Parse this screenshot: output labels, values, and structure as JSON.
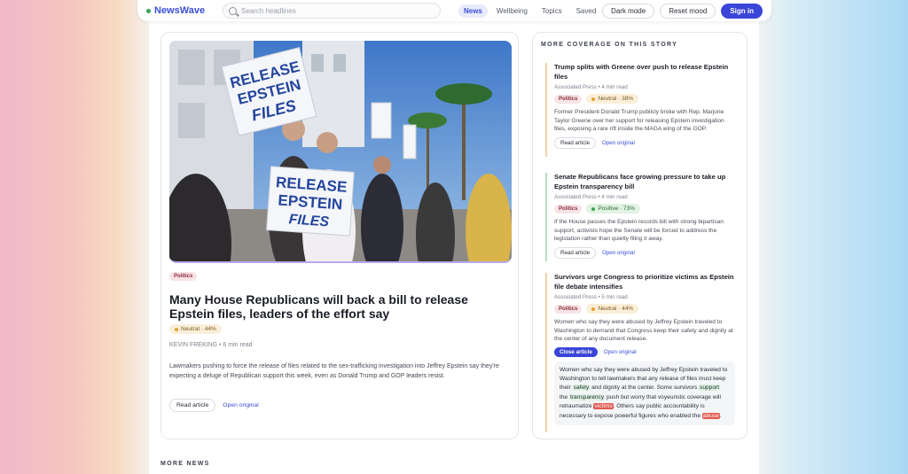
{
  "app": {
    "brand": "NewsWave"
  },
  "search": {
    "placeholder": "Search headlines"
  },
  "nav": {
    "items": [
      "News",
      "Wellbeing",
      "Topics",
      "Saved"
    ],
    "active": "News"
  },
  "actions": {
    "dark_mode": "Dark mode",
    "reset_mood": "Reset mood",
    "sign_in": "Sign in"
  },
  "colors": {
    "accent": "#3a46d8",
    "neutral": "#e2a12e",
    "positive": "#3da24f",
    "negative": "#e05a4e"
  },
  "main_story": {
    "image_signs": {
      "line1": "RELEASE",
      "line2": "EPSTEIN",
      "line3": "FILES"
    },
    "topic": "Politics",
    "title": "Many House Republicans will back a bill to release Epstein files, leaders of the effort say",
    "sentiment": "Neutral · 44%",
    "byline": "KEVIN FREKING • 6 min read",
    "summary": "Lawmakers pushing to force the release of files related to the sex-trafficking investigation into Jeffrey Epstein say they're expecting a deluge of Republican support this week, even as Donald Trump and GOP leaders resist.",
    "read_label": "Read article",
    "open_label": "Open original"
  },
  "coverage": {
    "heading": "MORE COVERAGE ON THIS STORY",
    "stories": [
      {
        "title": "Trump splits with Greene over push to release Epstein files",
        "byline": "Associated Press • 4 min read",
        "topic": "Politics",
        "sentiment": "Neutral · 38%",
        "summary": "Former President Donald Trump publicly broke with Rep. Marjorie Taylor Greene over her support for releasing Epstein investigation files, exposing a rare rift inside the MAGA wing of the GOP.",
        "read_label": "Read article",
        "open_label": "Open original"
      },
      {
        "title": "Senate Republicans face growing pressure to take up Epstein transparency bill",
        "byline": "Associated Press • 4 min read",
        "topic": "Politics",
        "sentiment": "Positive · 73%",
        "summary": "If the House passes the Epstein records bill with strong bipartisan support, activists hope the Senate will be forced to address the legislation rather than quietly filing it away.",
        "read_label": "Read article",
        "open_label": "Open original"
      },
      {
        "title": "Survivors urge Congress to prioritize victims as Epstein file debate intensifies",
        "byline": "Associated Press • 5 min read",
        "topic": "Politics",
        "sentiment": "Neutral · 44%",
        "summary": "Women who say they were abused by Jeffrey Epstein traveled to Washington to demand that Congress keep their safety and dignity at the center of any document release.",
        "close_label": "Close article",
        "open_label": "Open original",
        "analysis": {
          "p1": "Women who say they were abused by Jeffrey Epstein traveled to Washington to tell lawmakers that any release of files must keep their ",
          "w_safety": "safety",
          "p2": " and dignity at the center. Some survivors ",
          "w_support": "support",
          "p3": " the ",
          "w_transparency": "transparency",
          "p4": " push but worry that voyeuristic coverage will retraumatize ",
          "w_victims": "victims",
          "p5": ". Others say public accountability is necessary to expose powerful figures who enabled the ",
          "w_abuse": "abuse",
          "p6": "."
        }
      }
    ]
  },
  "more_news": {
    "heading": "MORE NEWS"
  }
}
